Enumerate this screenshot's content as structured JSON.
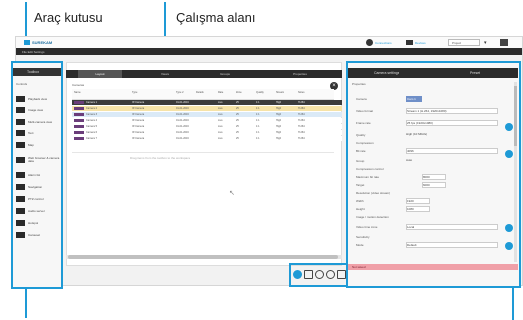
{
  "callouts": {
    "toolbox": "Araç kutusu",
    "workspace": "Çalışma alanı"
  },
  "app": {
    "logo_text": "SUREKAM",
    "menu_text": "File  Edit  Settings",
    "top_right": [
      "Connections",
      "Devices",
      "Project"
    ]
  },
  "toolbox": {
    "title": "Toolbox",
    "subtitle": "Controls",
    "items": [
      {
        "label": "Playback view",
        "icon": "monitor-icon"
      },
      {
        "label": "Image view",
        "icon": "image-icon"
      },
      {
        "label": "Multi-camera view",
        "icon": "grid-icon"
      },
      {
        "label": "Text",
        "icon": "text-icon"
      },
      {
        "label": "Map",
        "icon": "map-icon"
      },
      {
        "label": "Web browser & camera data",
        "icon": "browser-icon"
      },
      {
        "label": "Alarm list",
        "icon": "alarm-icon"
      },
      {
        "label": "Navigation",
        "icon": "navigation-icon"
      },
      {
        "label": "PTZ control",
        "icon": "ptz-icon"
      },
      {
        "label": "Audio server",
        "icon": "audio-icon"
      },
      {
        "label": "Hotspot",
        "icon": "hotspot-icon"
      },
      {
        "label": "Carousel",
        "icon": "carousel-icon"
      }
    ]
  },
  "workspace": {
    "tabs": [
      "Layout",
      "Views",
      "Groups",
      "Properties"
    ],
    "section": "Cameras",
    "columns": [
      "Name",
      "Type",
      "Type 2",
      "Details",
      "Rate",
      "Zone",
      "Quality",
      "Stream",
      "Notes"
    ],
    "rows": [
      [
        "Camera 1",
        "IP-Camera",
        "01-01-2016",
        "Live",
        "25",
        "1:1",
        "High",
        "H.264"
      ],
      [
        "Camera 2",
        "IP-Camera",
        "01-01-2016",
        "Live",
        "25",
        "1:1",
        "High",
        "H.264"
      ],
      [
        "Camera 3",
        "IP-Camera",
        "01-01-2016",
        "Live",
        "25",
        "1:1",
        "High",
        "H.264"
      ],
      [
        "Camera 4",
        "IP-Camera",
        "01-01-2016",
        "Live",
        "25",
        "1:1",
        "High",
        "H.264"
      ],
      [
        "Camera 5",
        "IP-Camera",
        "01-01-2016",
        "Live",
        "25",
        "1:1",
        "High",
        "H.264"
      ],
      [
        "Camera 6",
        "IP-Camera",
        "01-01-2016",
        "Live",
        "25",
        "1:1",
        "High",
        "H.264"
      ],
      [
        "Camera 7",
        "IP-Camera",
        "01-01-2016",
        "Live",
        "25",
        "1:1",
        "High",
        "H.264"
      ]
    ],
    "drop_hint": "Drag items from the toolbox to the workspace"
  },
  "properties": {
    "tabs": [
      "Camera settings",
      "Preset"
    ],
    "header": "Properties",
    "fields": [
      {
        "label": "Camera",
        "value": "Cam 1"
      },
      {
        "label": "Video format",
        "value": "Stream 1 (H.264, 1920x1080)"
      },
      {
        "label": "Frame rate",
        "value": "25 fps (1920x1080)"
      },
      {
        "label": "Quality",
        "value": "High (10 Mbit/s)"
      },
      {
        "label": "Compression",
        "value": "Low"
      },
      {
        "label": "Bit rate",
        "value": "4096"
      },
      {
        "label": "Group",
        "value": "Auto"
      },
      {
        "label": "Compression control",
        "value": ""
      },
      {
        "label": "Maximum bit rate",
        "value": "8000"
      },
      {
        "label": "Target",
        "value": "6000"
      },
      {
        "label": "Resolution (video stream)",
        "value": ""
      },
      {
        "label": "Width",
        "value": "1920"
      },
      {
        "label": "Height",
        "value": "1080"
      },
      {
        "label": "Image / motion detection",
        "value": ""
      },
      {
        "label": "Video time zone",
        "value": "Local"
      },
      {
        "label": "Sensitivity",
        "value": ""
      },
      {
        "label": "Mode",
        "value": "Default"
      }
    ],
    "status": "Not saved"
  },
  "colors": {
    "accent": "#1e9ad6",
    "titlebar": "#2b2b2b",
    "selected_row": "#f6e3a8",
    "status_bar": "#f0a0a8"
  }
}
